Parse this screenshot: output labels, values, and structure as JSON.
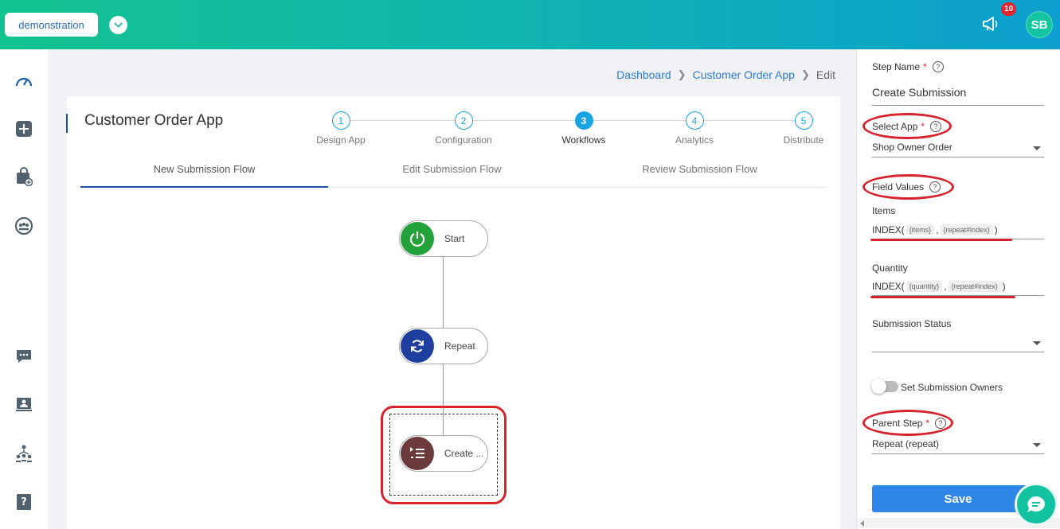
{
  "topbar": {
    "org_name": "demonstration",
    "notification_count": "10",
    "user_initials": "SB"
  },
  "sidebar": {
    "icons": [
      "dashboard-icon",
      "add-square-icon",
      "bag-add-icon",
      "group-icon",
      "chat-icon",
      "contact-card-icon",
      "org-chart-icon",
      "help-book-icon"
    ]
  },
  "breadcrumb": {
    "items": [
      "Dashboard",
      "Customer Order App",
      "Edit"
    ]
  },
  "app": {
    "title": "Customer Order App",
    "steps": [
      {
        "number": "1",
        "label": "Design App"
      },
      {
        "number": "2",
        "label": "Configuration"
      },
      {
        "number": "3",
        "label": "Workflows"
      },
      {
        "number": "4",
        "label": "Analytics"
      },
      {
        "number": "5",
        "label": "Distribute"
      }
    ],
    "active_step": 3,
    "tabs": [
      "New Submission Flow",
      "Edit Submission Flow",
      "Review Submission Flow"
    ],
    "active_tab": 0
  },
  "flow": {
    "nodes": [
      {
        "label": "Start",
        "icon": "power-icon",
        "color": "#23a23a"
      },
      {
        "label": "Repeat",
        "icon": "refresh-icon",
        "color": "#1e3f9e"
      },
      {
        "label": "Create ...",
        "icon": "create-list-icon",
        "color": "#6b3a3a"
      }
    ]
  },
  "panel": {
    "step_name_label": "Step Name",
    "required_mark": "*",
    "step_name_value": "Create Submission",
    "select_app_label": "Select App",
    "select_app_value": "Shop Owner Order",
    "field_values_label": "Field Values",
    "items_label": "Items",
    "items_formula": {
      "fn": "INDEX(",
      "arg1": "{items}",
      "comma": ",",
      "arg2": "{repeat#index}",
      "close": ")"
    },
    "quantity_label": "Quantity",
    "quantity_formula": {
      "fn": "INDEX(",
      "arg1": "{quantity}",
      "comma": ",",
      "arg2": "{repeat#index}",
      "close": ")"
    },
    "submission_status_label": "Submission Status",
    "submission_status_value": "",
    "set_owners_label": "Set Submission Owners",
    "parent_step_label": "Parent Step",
    "parent_step_value": "Repeat (repeat)",
    "save_label": "Save",
    "help_glyph": "?"
  },
  "colors": {
    "accent": "#19a4e4",
    "primary_button": "#2e86e6",
    "annotation_red": "#d7232e"
  }
}
